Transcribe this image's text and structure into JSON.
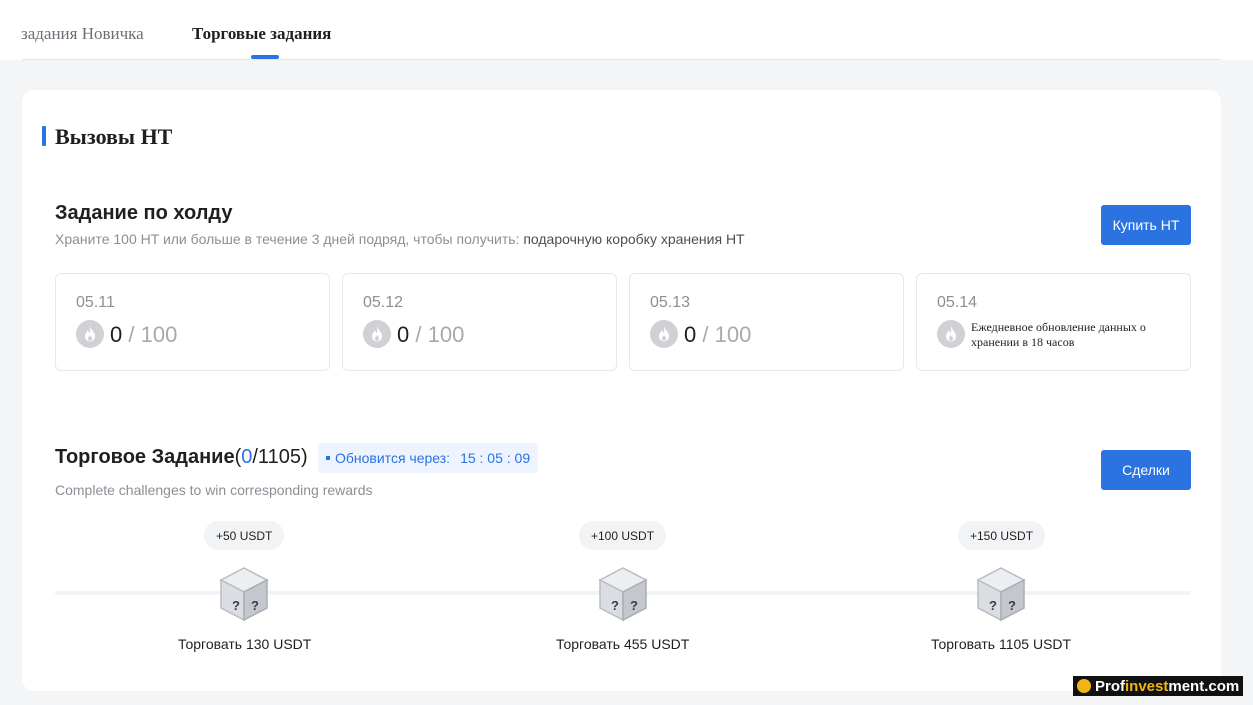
{
  "tabs": [
    {
      "label": "задания Новичка",
      "active": false
    },
    {
      "label": "Торговые задания",
      "active": true
    }
  ],
  "section": {
    "title": "Вызовы HT"
  },
  "hold_task": {
    "title": "Задание по холду",
    "subtitle": "Храните 100 HT или больше в течение 3 дней подряд, чтобы получить:",
    "reward": "подарочную коробку хранения HT",
    "button": "Купить HT",
    "days": [
      {
        "date": "05.11",
        "current": "0",
        "total": "/ 100"
      },
      {
        "date": "05.12",
        "current": "0",
        "total": "/ 100"
      },
      {
        "date": "05.13",
        "current": "0",
        "total": "/ 100"
      },
      {
        "date": "05.14",
        "note": "Ежедневное обновление данных о хранении в 18 часов"
      }
    ]
  },
  "trade_task": {
    "title": "Торговое Задание",
    "count": "0",
    "total": "/1105",
    "paren_open": "(",
    "paren_close": ")",
    "timer_label": "Обновится через:",
    "timer_value": "15 : 05 : 09",
    "subtitle": "Complete challenges to win corresponding rewards",
    "button": "Сделки",
    "milestones": [
      {
        "reward": "+50 USDT",
        "label": "Торговать 130 USDT"
      },
      {
        "reward": "+100 USDT",
        "label": "Торговать 455 USDT"
      },
      {
        "reward": "+150 USDT",
        "label": "Торговать 1105 USDT"
      }
    ]
  },
  "watermark": {
    "prefix": "Prof",
    "highlight": "invest",
    "suffix": "ment.com"
  },
  "colors": {
    "accent": "#2a73e0",
    "muted": "#8b8f96",
    "track": "#f2f3f5"
  }
}
